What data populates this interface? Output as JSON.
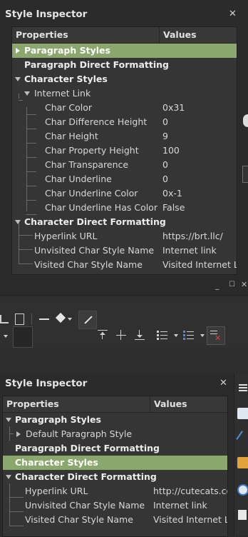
{
  "colors": {
    "selected": "#8aa86e",
    "panel": "#353535",
    "background": "#2b2b2b"
  },
  "top_panel": {
    "title": "Style Inspector",
    "close_icon": "close-icon",
    "columns": {
      "properties": "Properties",
      "values": "Values"
    },
    "rows": [
      {
        "label": "Paragraph Styles",
        "value": "",
        "bold": true,
        "selected": true,
        "expander": "right"
      },
      {
        "label": "Paragraph Direct Formatting",
        "value": "",
        "bold": true
      },
      {
        "label": "Character Styles",
        "value": "",
        "bold": true,
        "expander": "down"
      },
      {
        "label": "Internet Link",
        "value": "",
        "expander": "down"
      },
      {
        "label": "Char Color",
        "value": "0x31"
      },
      {
        "label": "Char Difference Height",
        "value": "0"
      },
      {
        "label": "Char Height",
        "value": "9"
      },
      {
        "label": "Char Property Height",
        "value": "100"
      },
      {
        "label": "Char Transparence",
        "value": "0"
      },
      {
        "label": "Char Underline",
        "value": "0"
      },
      {
        "label": "Char Underline Color",
        "value": "0x-1"
      },
      {
        "label": "Char Underline Has Color",
        "value": "False"
      },
      {
        "label": "Character Direct Formatting",
        "value": "",
        "bold": true,
        "expander": "down"
      },
      {
        "label": "Hyperlink URL",
        "value": "https://brt.llc/"
      },
      {
        "label": "Unvisited Char Style Name",
        "value": "Internet link"
      },
      {
        "label": "Visited Char Style Name",
        "value": "Visited Internet Link"
      }
    ]
  },
  "middle": {
    "window_controls": [
      "minimize-icon",
      "maximize-icon",
      "close-icon"
    ],
    "toolbar_icons": [
      "insert-table-icon",
      "insert-page-icon",
      "line-icon",
      "diamond-shape-icon",
      "draw-function-icon",
      "character-style-swatch-icon",
      "align-top-icon",
      "center-vertically-icon",
      "align-bottom-icon",
      "bulleted-list-icon",
      "numbered-list-icon",
      "delete-table-icon"
    ]
  },
  "bottom_panel": {
    "title": "Style Inspector",
    "close_icon": "close-icon",
    "columns": {
      "properties": "Properties",
      "values": "Values"
    },
    "rows": [
      {
        "label": "Paragraph Styles",
        "value": "",
        "bold": true,
        "expander": "down"
      },
      {
        "label": "Default Paragraph Style",
        "value": "",
        "expander": "right"
      },
      {
        "label": "Paragraph Direct Formatting",
        "value": "",
        "bold": true
      },
      {
        "label": "Character Styles",
        "value": "",
        "bold": true,
        "selected": true
      },
      {
        "label": "Character Direct Formatting",
        "value": "",
        "bold": true,
        "expander": "down"
      },
      {
        "label": "Hyperlink URL",
        "value": "http://cutecats.com"
      },
      {
        "label": "Unvisited Char Style Name",
        "value": "Internet link"
      },
      {
        "label": "Visited Char Style Name",
        "value": "Visited Internet Link"
      }
    ]
  },
  "right_sidebar_icons": [
    "menu-icon",
    "properties-icon",
    "styles-icon",
    "gallery-icon",
    "navigator-icon",
    "page-icon"
  ]
}
